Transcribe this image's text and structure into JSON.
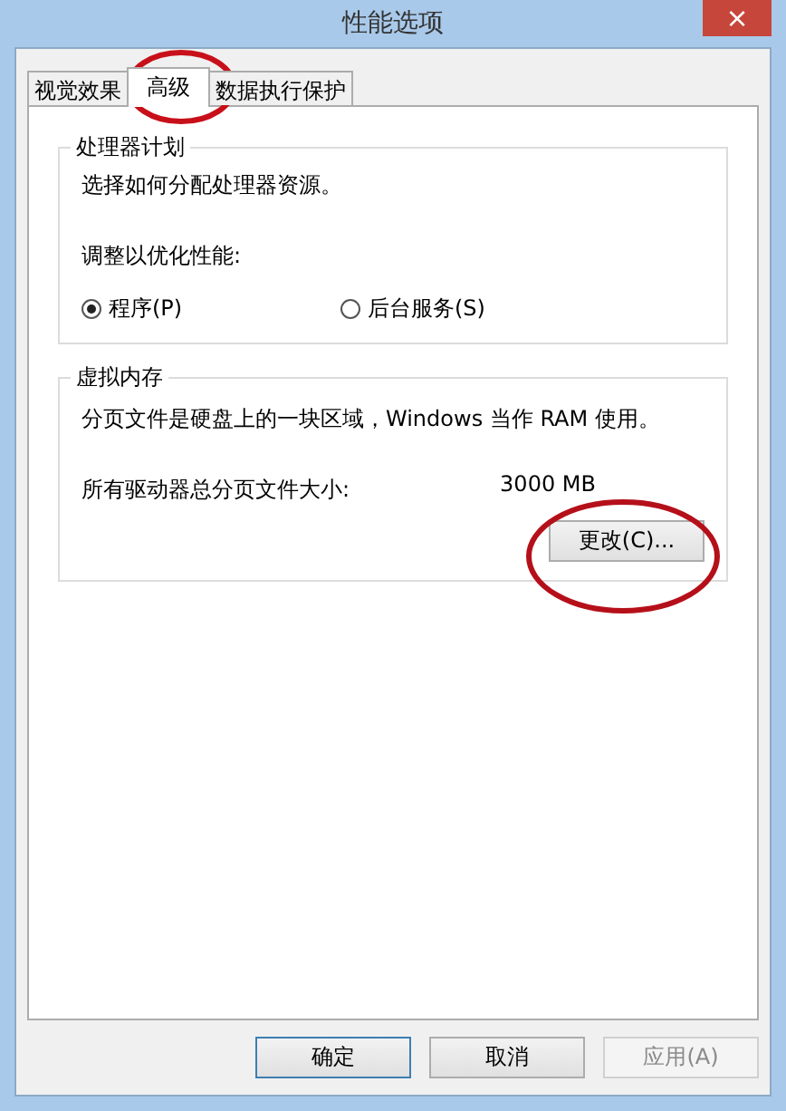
{
  "window": {
    "title": "性能选项",
    "close": "×"
  },
  "tabs": [
    {
      "label": "视觉效果",
      "selected": false
    },
    {
      "label": "高级",
      "selected": true
    },
    {
      "label": "数据执行保护",
      "selected": false
    }
  ],
  "processor_group": {
    "title": "处理器计划",
    "description": "选择如何分配处理器资源。",
    "prompt": "调整以优化性能:",
    "options": [
      {
        "label": "程序(P)",
        "selected": true
      },
      {
        "label": "后台服务(S)",
        "selected": false
      }
    ]
  },
  "memory_group": {
    "title": "虚拟内存",
    "description": "分页文件是硬盘上的一块区域，Windows 当作 RAM 使用。",
    "size_label": "所有驱动器总分页文件大小:",
    "size_value": "3000 MB",
    "change_button": "更改(C)..."
  },
  "buttons": [
    {
      "label": "确定",
      "default": true,
      "disabled": false
    },
    {
      "label": "取消",
      "default": false,
      "disabled": false
    },
    {
      "label": "应用(A)",
      "default": false,
      "disabled": true
    }
  ]
}
